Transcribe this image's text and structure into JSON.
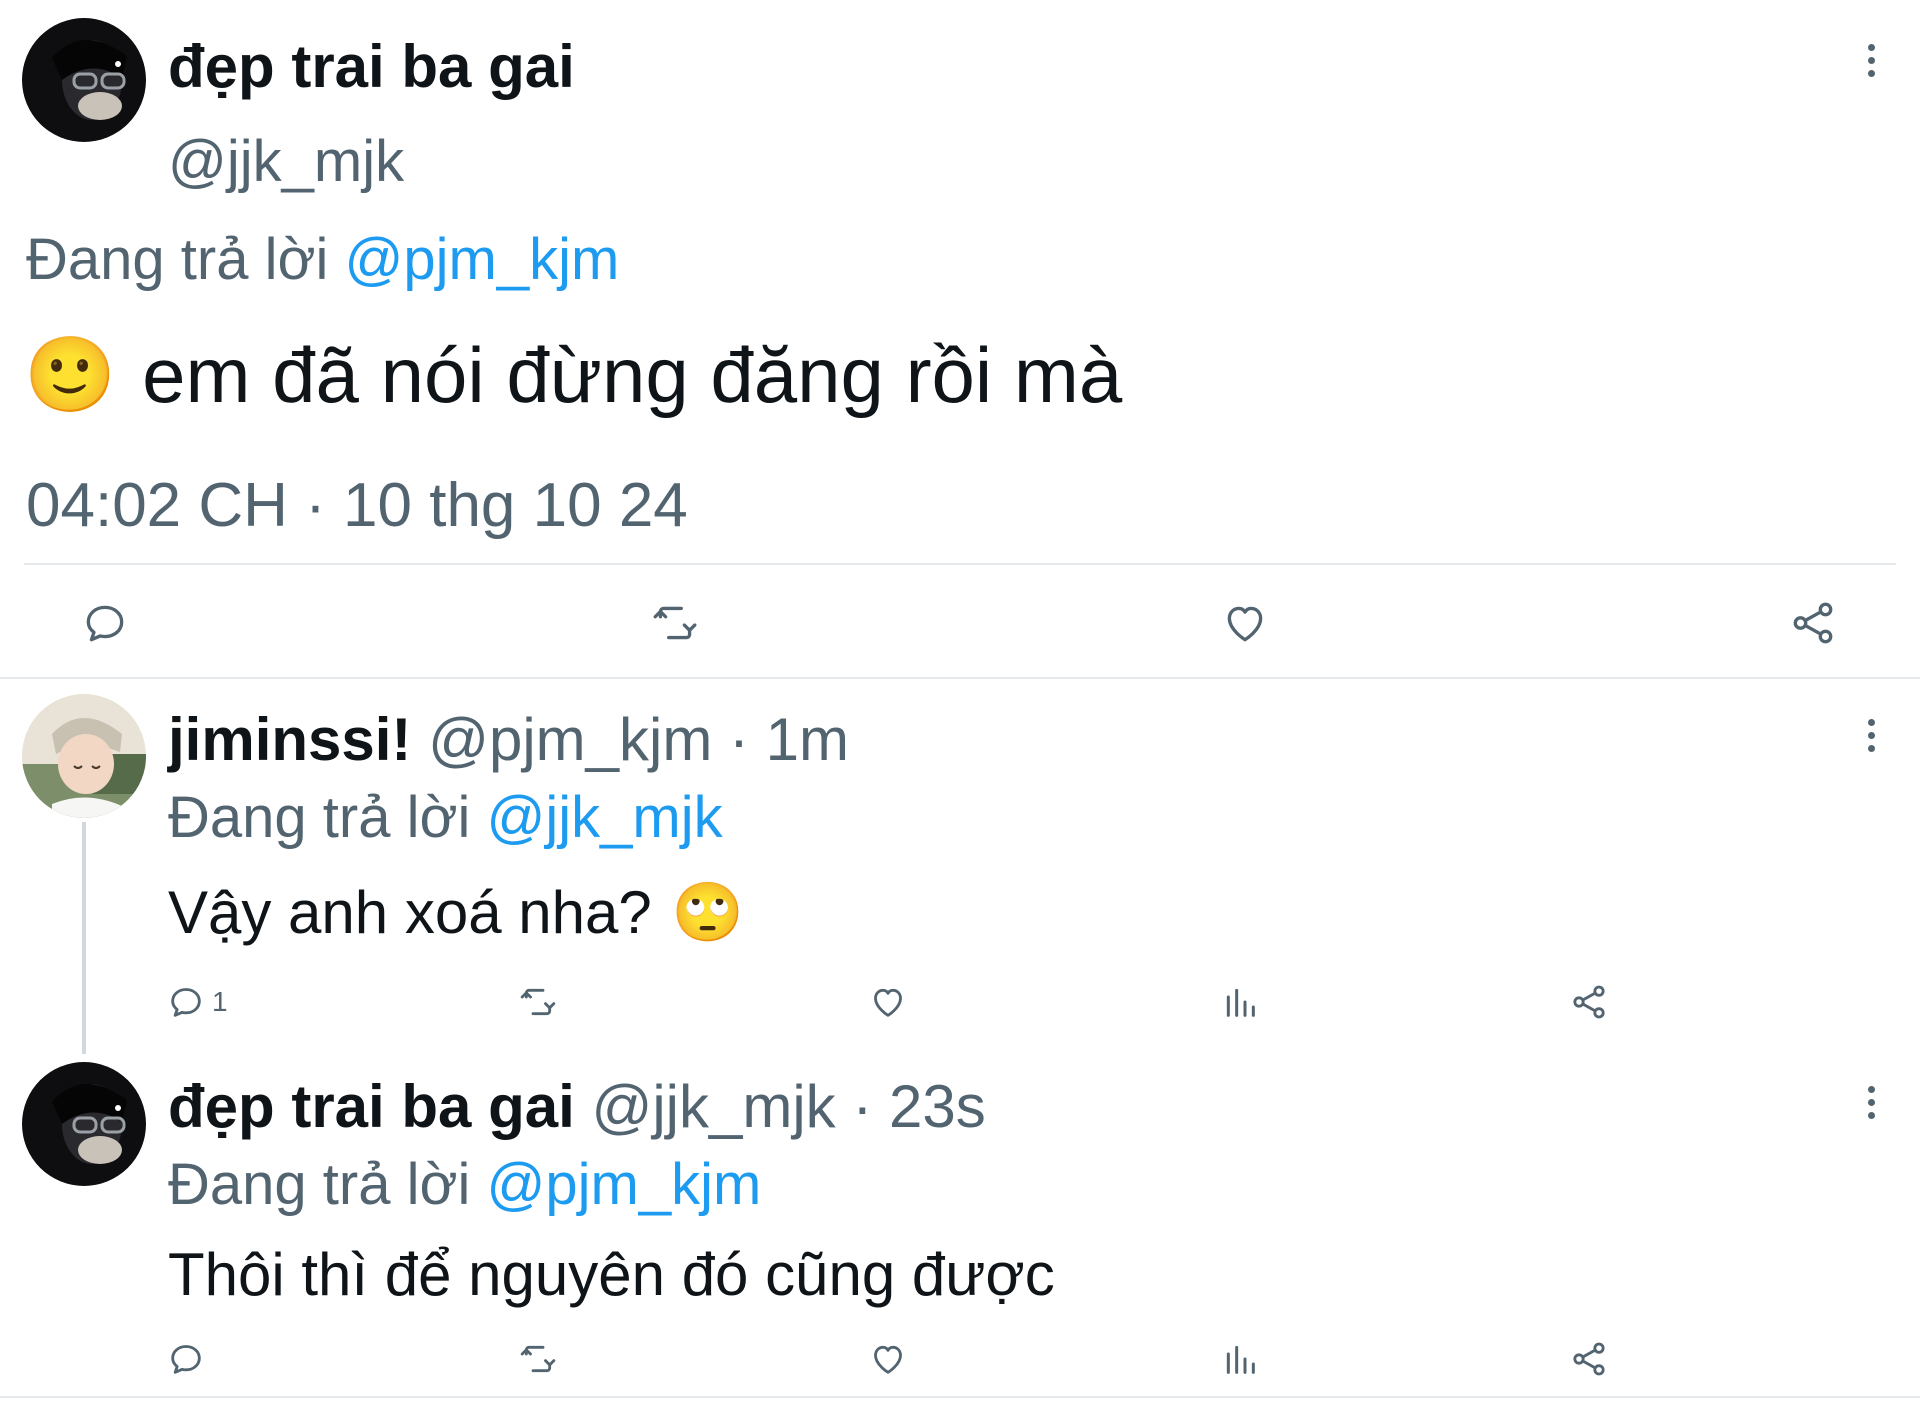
{
  "colors": {
    "accent": "#1d9bf0",
    "muted": "#536471",
    "text": "#0f1419",
    "divider": "#e6e9eb"
  },
  "main_tweet": {
    "display_name": "đẹp trai ba gai",
    "handle": "@jjk_mjk",
    "reply_prefix": "Đang trả lời",
    "reply_to": "@pjm_kjm",
    "text_emoji": "🙂",
    "text": "em đã nói đừng đăng rồi mà",
    "timestamp": "04:02 CH · 10 thg 10 24",
    "actions": [
      "reply-icon",
      "retweet-icon",
      "like-icon",
      "share-icon"
    ]
  },
  "replies": [
    {
      "display_name": "jiminssi!",
      "meta": "@pjm_kjm · 1m",
      "reply_prefix": "Đang trả lời",
      "reply_to": "@jjk_mjk",
      "text": "Vậy anh xoá nha?",
      "text_emoji": "🙄",
      "reply_count": "1",
      "actions": [
        "reply-icon",
        "retweet-icon",
        "like-icon",
        "views-icon",
        "share-icon"
      ]
    },
    {
      "display_name": "đẹp trai ba gai",
      "meta": "@jjk_mjk · 23s",
      "reply_prefix": "Đang trả lời",
      "reply_to": "@pjm_kjm",
      "text": "Thôi thì để nguyên đó cũng được",
      "reply_count": "",
      "actions": [
        "reply-icon",
        "retweet-icon",
        "like-icon",
        "views-icon",
        "share-icon"
      ]
    }
  ]
}
